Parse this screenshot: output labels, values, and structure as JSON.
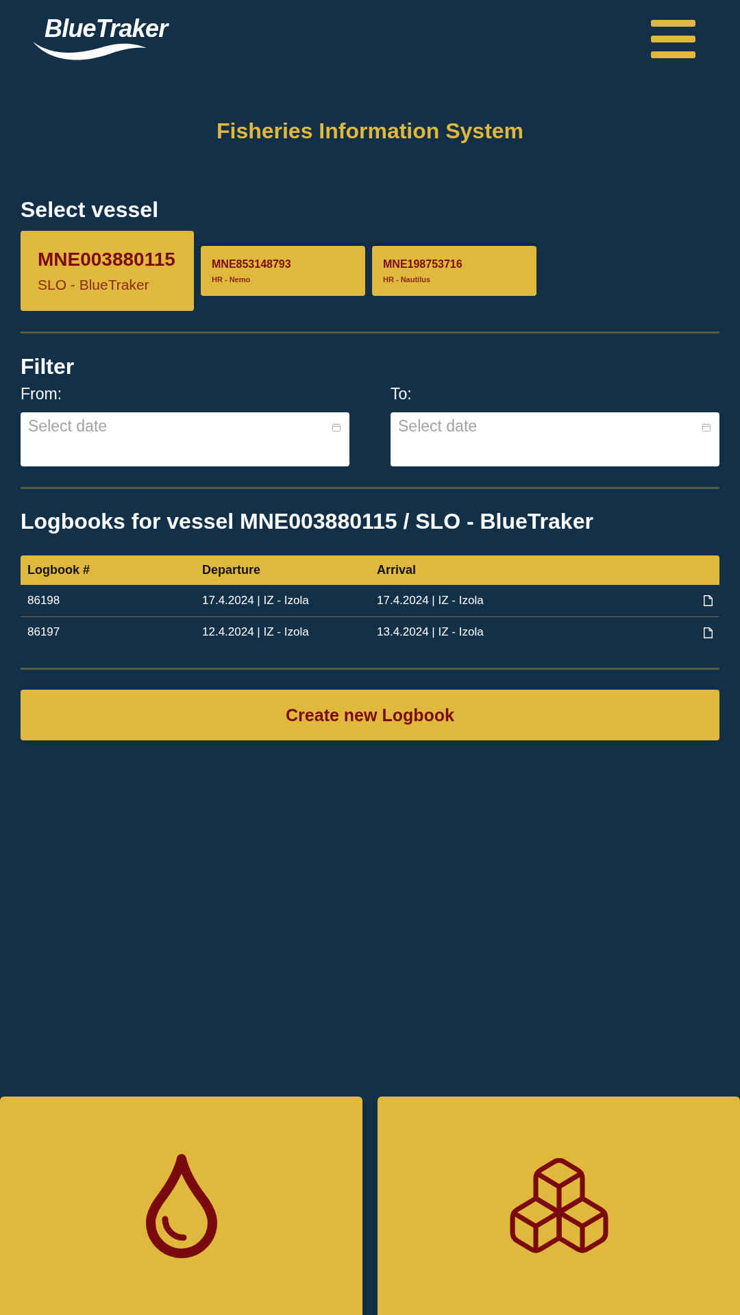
{
  "header": {
    "logo": "BlueTraker"
  },
  "title": "Fisheries Information System",
  "vessel_select": {
    "heading": "Select vessel",
    "vessels": [
      {
        "id": "MNE003880115",
        "name": "SLO - BlueTraker",
        "selected": true
      },
      {
        "id": "MNE853148793",
        "name": "HR - Nemo",
        "selected": false
      },
      {
        "id": "MNE198753716",
        "name": "HR - Nautilus",
        "selected": false
      }
    ]
  },
  "filter": {
    "heading": "Filter",
    "fields": [
      {
        "label": "From:",
        "placeholder": "Select date"
      },
      {
        "label": "To:",
        "placeholder": "Select date"
      }
    ]
  },
  "logbooks": {
    "heading": "Logbooks for vessel MNE003880115 / SLO - BlueTraker",
    "columns": [
      "Logbook #",
      "Departure",
      "Arrival"
    ],
    "rows": [
      [
        "86198",
        "17.4.2024 | IZ - Izola",
        "17.4.2024 | IZ - Izola"
      ],
      [
        "86197",
        "12.4.2024 | IZ - Izola",
        "13.4.2024 | IZ - Izola"
      ]
    ]
  },
  "create_button": "Create new Logbook",
  "tiles": [
    {
      "kind": "droplet"
    },
    {
      "kind": "cubes"
    }
  ]
}
